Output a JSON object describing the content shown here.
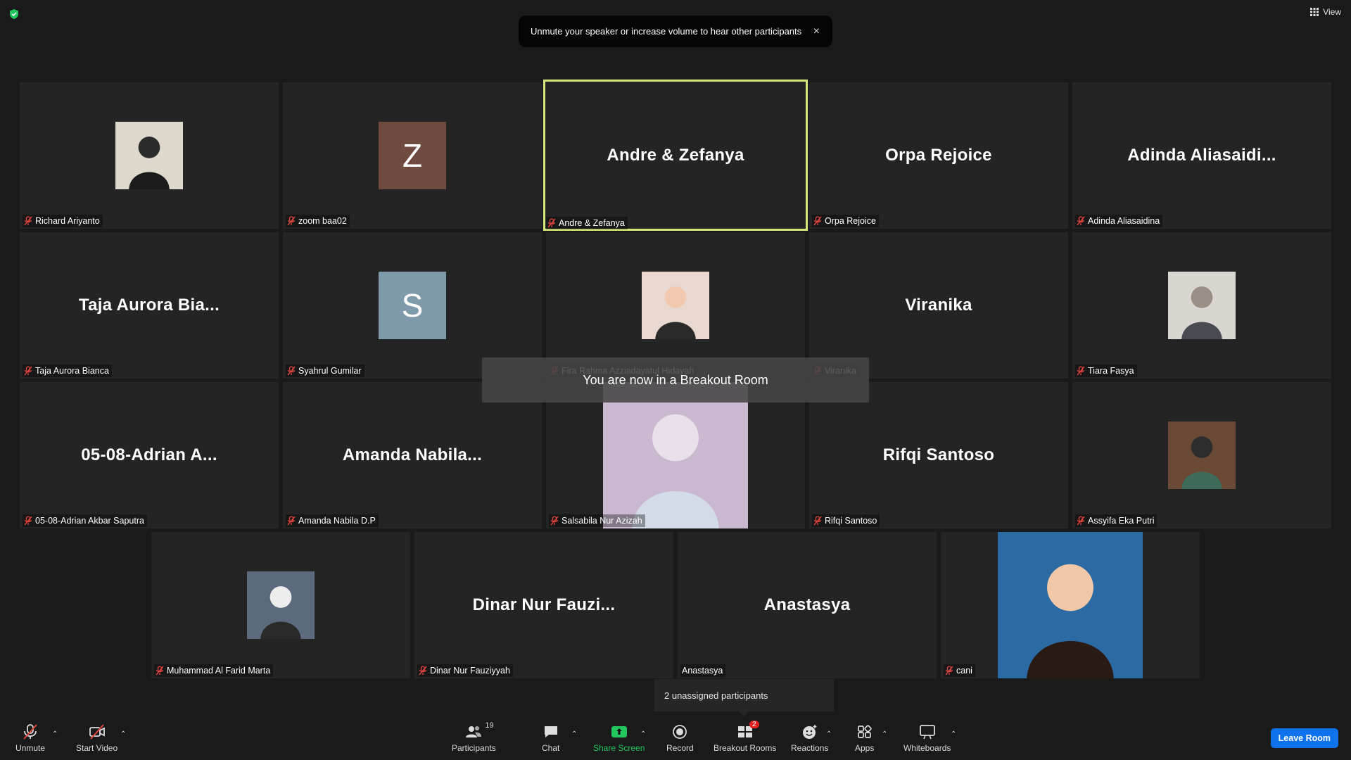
{
  "top": {
    "view_label": "View"
  },
  "notice": {
    "text": "Unmute your speaker or increase volume to hear other participants",
    "close_glyph": "×"
  },
  "tiles": [
    {
      "name": "Richard Ariyanto",
      "type": "photo"
    },
    {
      "name": "zoom baa02",
      "type": "avatar",
      "letter": "Z",
      "color": "#6f4a3e"
    },
    {
      "name": "Andre & Zefanya",
      "display": "Andre & Zefanya",
      "type": "text",
      "active": true
    },
    {
      "name": "Orpa Rejoice",
      "display": "Orpa Rejoice",
      "type": "text"
    },
    {
      "name": "Adinda Aliasaidina",
      "display": "Adinda  Aliasaidi...",
      "type": "text"
    },
    {
      "name": "Taja Aurora Bianca",
      "display": "Taja  Aurora  Bia...",
      "type": "text"
    },
    {
      "name": "Syahrul Gumilar",
      "type": "avatar",
      "letter": "S",
      "color": "#7f9aab"
    },
    {
      "name": "Fira Rahma Azziadayatul Hidayah",
      "type": "photo"
    },
    {
      "name": "Viranika",
      "display": "Viranika",
      "type": "text"
    },
    {
      "name": "Tiara Fasya",
      "type": "photo"
    },
    {
      "name": "05-08-Adrian Akbar Saputra",
      "display": "05-08-Adrian  A...",
      "type": "text"
    },
    {
      "name": "Amanda Nabila D.P",
      "display": "Amanda  Nabila...",
      "type": "text"
    },
    {
      "name": "Salsabila Nur Azizah",
      "type": "photo"
    },
    {
      "name": "Rifqi Santoso",
      "display": "Rifqi Santoso",
      "type": "text"
    },
    {
      "name": "Assyifa Eka Putri",
      "type": "photo"
    },
    {
      "name": "Muhammad Al Farid Marta",
      "type": "photo"
    },
    {
      "name": "Dinar Nur Fauziyyah",
      "display": "Dinar  Nur  Fauzi...",
      "type": "text"
    },
    {
      "name": "Anastasya",
      "display": "Anastasya",
      "type": "text",
      "no_mic": true
    },
    {
      "name": "cani",
      "type": "photo"
    }
  ],
  "breakout_toast": "You are now in a Breakout Room",
  "unassigned": "2 unassigned participants",
  "toolbar": {
    "unmute": "Unmute",
    "start_video": "Start Video",
    "participants": "Participants",
    "participants_count": "19",
    "chat": "Chat",
    "share_screen": "Share Screen",
    "record": "Record",
    "breakout_rooms": "Breakout Rooms",
    "breakout_badge": "2",
    "reactions": "Reactions",
    "apps": "Apps",
    "whiteboards": "Whiteboards",
    "leave_room": "Leave Room"
  },
  "colors": {
    "active_border": "#d7e67b",
    "leave_button": "#0e72ed",
    "share_green": "#22c55e",
    "mute_red": "#e0443e"
  }
}
